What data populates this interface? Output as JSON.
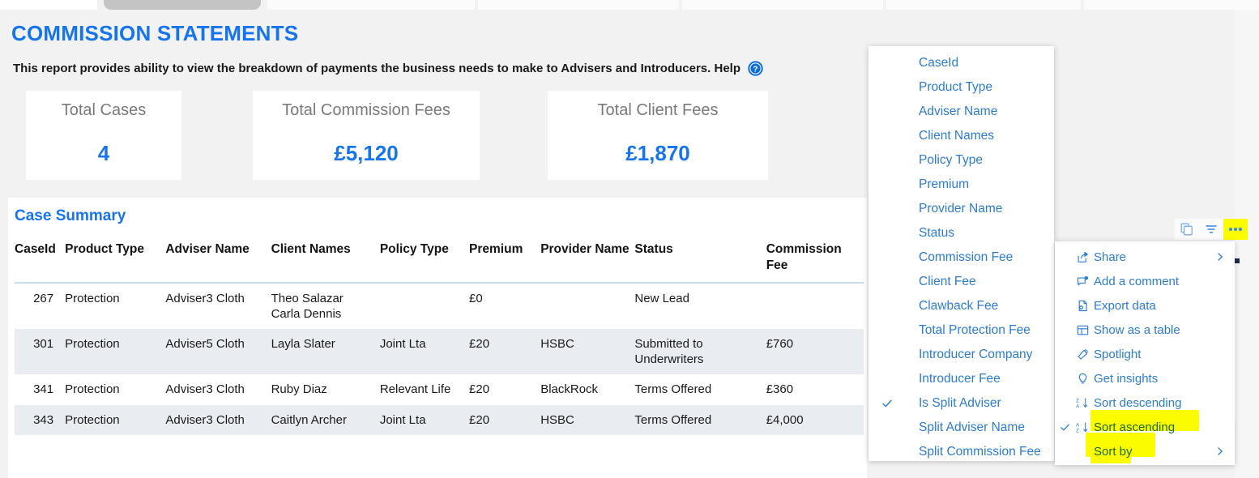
{
  "report": {
    "title": "COMMISSION STATEMENTS",
    "subtitle": "This report provides ability to view the breakdown of payments the business needs to make to Advisers and Introducers. Help",
    "help_icon": "help-circle-icon",
    "accent_color": "#1675ee",
    "highlight_color": "#fcfc00"
  },
  "cards": [
    {
      "label": "Total Cases",
      "value": "4"
    },
    {
      "label": "Total Commission Fees",
      "value": "£5,120"
    },
    {
      "label": "Total Client Fees",
      "value": "£1,870"
    }
  ],
  "case_summary": {
    "title": "Case Summary",
    "columns": [
      "CaseId",
      "Product Type",
      "Adviser Name",
      "Client Names",
      "Policy Type",
      "Premium",
      "Provider Name",
      "Status",
      "Commission Fee"
    ],
    "rows": [
      {
        "caseid": "267",
        "product_type": "Protection",
        "adviser_name": "Adviser3 Cloth",
        "client_names": [
          "Theo Salazar",
          "Carla Dennis"
        ],
        "policy_type": "",
        "premium": "£0",
        "provider_name": "",
        "status": [
          "New Lead"
        ],
        "commission_fee": ""
      },
      {
        "caseid": "301",
        "product_type": "Protection",
        "adviser_name": "Adviser5 Cloth",
        "client_names": [
          "Layla Slater"
        ],
        "policy_type": "Joint Lta",
        "premium": "£20",
        "provider_name": "HSBC",
        "status": [
          "Submitted to",
          "Underwriters"
        ],
        "commission_fee": "£760"
      },
      {
        "caseid": "341",
        "product_type": "Protection",
        "adviser_name": "Adviser3 Cloth",
        "client_names": [
          "Ruby Diaz"
        ],
        "policy_type": "Relevant Life",
        "premium": "£20",
        "provider_name": "BlackRock",
        "status": [
          "Terms Offered"
        ],
        "commission_fee": "£360"
      },
      {
        "caseid": "343",
        "product_type": "Protection",
        "adviser_name": "Adviser3 Cloth",
        "client_names": [
          "Caitlyn Archer"
        ],
        "policy_type": "Joint Lta",
        "premium": "£20",
        "provider_name": "HSBC",
        "status": [
          "Terms Offered"
        ],
        "commission_fee": "£4,000"
      }
    ]
  },
  "visual_toolbar": {
    "buttons": [
      {
        "name": "copy-visual-icon",
        "label": "Copy visual"
      },
      {
        "name": "filter-icon",
        "label": "Filters"
      },
      {
        "name": "more-options-icon",
        "label": "More options",
        "highlighted": true
      }
    ]
  },
  "field_list": {
    "items": [
      {
        "label": "CaseId",
        "checked": false
      },
      {
        "label": "Product Type",
        "checked": false
      },
      {
        "label": "Adviser Name",
        "checked": false
      },
      {
        "label": "Client Names",
        "checked": false
      },
      {
        "label": "Policy Type",
        "checked": false
      },
      {
        "label": "Premium",
        "checked": false
      },
      {
        "label": "Provider Name",
        "checked": false
      },
      {
        "label": "Status",
        "checked": false
      },
      {
        "label": "Commission Fee",
        "checked": false
      },
      {
        "label": "Client Fee",
        "checked": false
      },
      {
        "label": "Clawback Fee",
        "checked": false
      },
      {
        "label": "Total Protection Fee",
        "checked": false
      },
      {
        "label": "Introducer Company",
        "checked": false
      },
      {
        "label": "Introducer Fee",
        "checked": false
      },
      {
        "label": "Is Split Adviser",
        "checked": true
      },
      {
        "label": "Split Adviser Name",
        "checked": false
      },
      {
        "label": "Split Commission Fee",
        "checked": false
      }
    ]
  },
  "context_menu": {
    "items": [
      {
        "label": "Share",
        "icon": "share-icon",
        "submenu": true,
        "checked": false,
        "highlighted": false
      },
      {
        "label": "Add a comment",
        "icon": "comment-icon",
        "submenu": false,
        "checked": false,
        "highlighted": false
      },
      {
        "label": "Export data",
        "icon": "export-data-icon",
        "submenu": false,
        "checked": false,
        "highlighted": false
      },
      {
        "label": "Show as a table",
        "icon": "show-as-table-icon",
        "submenu": false,
        "checked": false,
        "highlighted": false
      },
      {
        "label": "Spotlight",
        "icon": "spotlight-icon",
        "submenu": false,
        "checked": false,
        "highlighted": false
      },
      {
        "label": "Get insights",
        "icon": "lightbulb-icon",
        "submenu": false,
        "checked": false,
        "highlighted": false
      },
      {
        "label": "Sort descending",
        "icon": "sort-descending-icon",
        "submenu": false,
        "checked": false,
        "highlighted": false
      },
      {
        "label": "Sort ascending",
        "icon": "sort-ascending-icon",
        "submenu": false,
        "checked": true,
        "highlighted": true
      },
      {
        "label": "Sort by",
        "icon": "",
        "submenu": true,
        "checked": false,
        "highlighted": true
      }
    ]
  }
}
